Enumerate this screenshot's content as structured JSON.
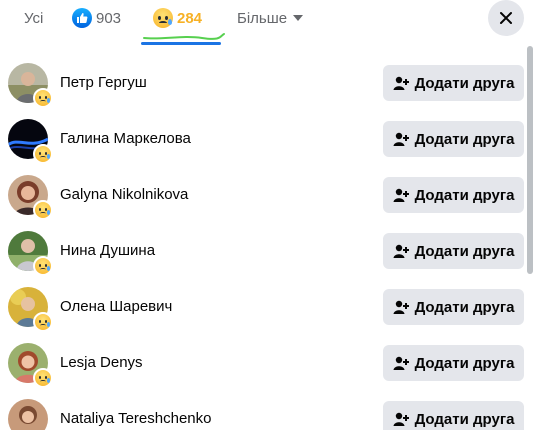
{
  "tabs": {
    "all_label": "Усі",
    "like_count": "903",
    "like_icon": "like-icon",
    "sad_count": "284",
    "sad_icon": "sad-icon",
    "more_label": "Більше"
  },
  "close_icon": "close-icon",
  "people": [
    {
      "name": "Петр Гергуш",
      "button": "Додати друга"
    },
    {
      "name": "Галина Маркелова",
      "button": "Додати друга"
    },
    {
      "name": "Galyna Nikolnikova",
      "button": "Додати друга"
    },
    {
      "name": "Нина Душина",
      "button": "Додати друга"
    },
    {
      "name": "Олена Шаревич",
      "button": "Додати друга"
    },
    {
      "name": "Lesja Denys",
      "button": "Додати друга"
    },
    {
      "name": "Nataliya Tereshchenko",
      "button": "Додати друга"
    }
  ],
  "colors": {
    "accent": "#1b74e4",
    "sad": "#f7b125",
    "button_bg": "#e4e6eb",
    "secondary_text": "#65676b"
  }
}
